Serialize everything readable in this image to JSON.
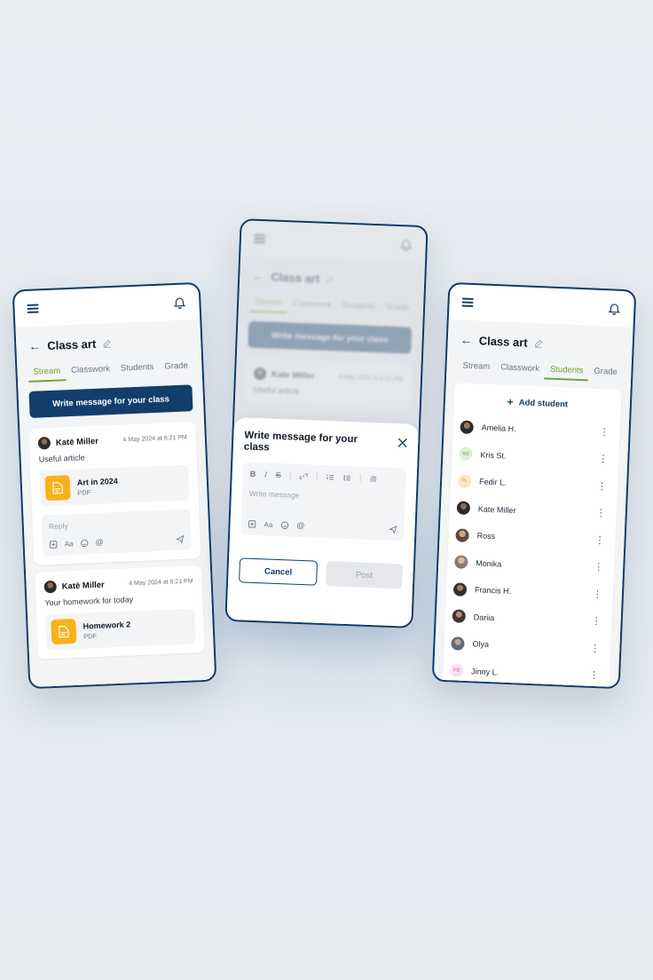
{
  "colors": {
    "primary": "#123e6b",
    "accent_green": "#6aa532",
    "file_orange": "#f6b21b"
  },
  "left": {
    "title": "Class art",
    "tabs": [
      "Stream",
      "Classwork",
      "Students",
      "Grade"
    ],
    "write_button": "Write message for your class",
    "posts": [
      {
        "author": "Katē Miller",
        "date": "4 May 2024 at 6:21 PM",
        "text": "Useful article",
        "attachment": {
          "name": "Art in 2024",
          "type": "PDF"
        },
        "reply_placeholder": "Reply"
      },
      {
        "author": "Katē Miller",
        "date": "4 May 2024 at 6:21 PM",
        "text": "Your homework for today",
        "attachment": {
          "name": "Homework 2",
          "type": "PDF"
        }
      }
    ]
  },
  "center": {
    "title": "Class art",
    "tabs": [
      "Stream",
      "Classwork",
      "Students",
      "Grade"
    ],
    "write_button": "Write message for your class",
    "post": {
      "author": "Kate Miller",
      "date": "4 May 2024 at 6:21 PM",
      "text": "Useful article"
    },
    "sheet": {
      "title": "Write message for your class",
      "format_tools": [
        "B",
        "I",
        "S"
      ],
      "placeholder": "Write message",
      "cancel": "Cancel",
      "post": "Post"
    }
  },
  "right": {
    "title": "Class art",
    "tabs": [
      "Stream",
      "Classwork",
      "Students",
      "Grade"
    ],
    "add_student": "Add student",
    "students": [
      {
        "name": "Amelia H.",
        "initials": ""
      },
      {
        "name": "Kris St.",
        "initials": "KS"
      },
      {
        "name": "Fedir L.",
        "initials": "FL"
      },
      {
        "name": "Kate Miller",
        "initials": ""
      },
      {
        "name": "Ross",
        "initials": ""
      },
      {
        "name": "Monika",
        "initials": ""
      },
      {
        "name": "Francis H.",
        "initials": ""
      },
      {
        "name": "Dariia",
        "initials": ""
      },
      {
        "name": "Olya",
        "initials": ""
      },
      {
        "name": "Jinny L.",
        "initials": "FD"
      }
    ]
  }
}
